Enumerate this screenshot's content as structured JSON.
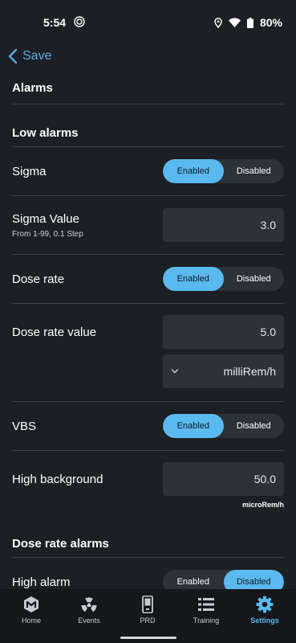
{
  "status_bar": {
    "time": "5:54",
    "battery": "80%"
  },
  "header": {
    "back_label": "Save"
  },
  "page": {
    "title": "Alarms"
  },
  "low_alarms": {
    "title": "Low alarms",
    "sigma": {
      "label": "Sigma",
      "options": [
        "Enabled",
        "Disabled"
      ],
      "selected": "Enabled"
    },
    "sigma_value": {
      "label": "Sigma Value",
      "hint": "From 1-99, 0.1 Step",
      "value": "3.0"
    },
    "dose_rate": {
      "label": "Dose rate",
      "options": [
        "Enabled",
        "Disabled"
      ],
      "selected": "Enabled"
    },
    "dose_rate_value": {
      "label": "Dose rate value",
      "value": "5.0",
      "unit_selected": "milliRem/h"
    },
    "vbs": {
      "label": "VBS",
      "options": [
        "Enabled",
        "Disabled"
      ],
      "selected": "Enabled"
    },
    "high_background": {
      "label": "High background",
      "value": "50.0",
      "unit": "microRem/h"
    }
  },
  "dose_rate_alarms": {
    "title": "Dose rate alarms",
    "high_alarm": {
      "label": "High alarm",
      "options": [
        "Enabled",
        "Disabled"
      ],
      "selected": "Disabled"
    }
  },
  "tabs": [
    {
      "label": "Home",
      "icon": "home-logo-icon"
    },
    {
      "label": "Events",
      "icon": "radiation-icon"
    },
    {
      "label": "PRD",
      "icon": "device-icon"
    },
    {
      "label": "Training",
      "icon": "list-icon"
    },
    {
      "label": "Settings",
      "icon": "gear-icon",
      "active": true
    }
  ],
  "colors": {
    "accent": "#5ab9ee",
    "background": "#1c1f24",
    "field": "#2d3138"
  }
}
